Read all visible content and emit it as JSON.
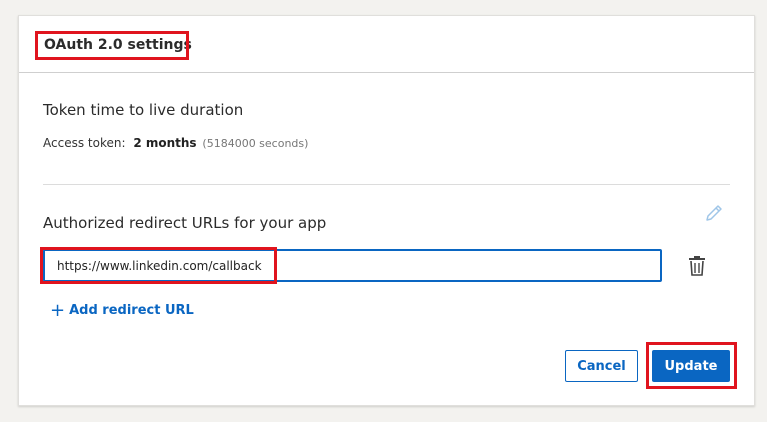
{
  "panel": {
    "title": "OAuth 2.0 settings"
  },
  "token": {
    "heading": "Token time to live duration",
    "label": "Access token:",
    "value": "2 months",
    "seconds": "(5184000 seconds)"
  },
  "redirect": {
    "heading": "Authorized redirect URLs for your app",
    "url_value": "https://www.linkedin.com/callback",
    "add_label": "Add redirect URL"
  },
  "actions": {
    "cancel_label": "Cancel",
    "update_label": "Update"
  },
  "icons": {
    "edit": "pencil-icon",
    "delete": "trash-icon",
    "add": "plus-icon"
  },
  "colors": {
    "accent": "#0a66c2",
    "highlight": "#e0141e"
  }
}
